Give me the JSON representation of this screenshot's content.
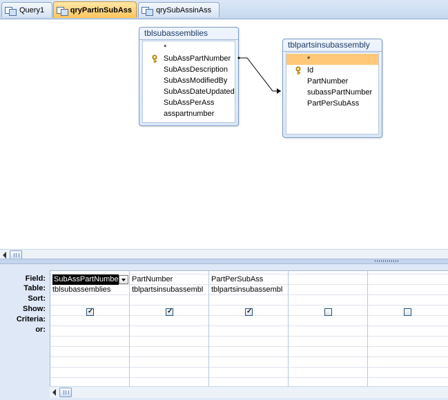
{
  "tabs": [
    {
      "label": "Query1",
      "active": false
    },
    {
      "label": "qryPartinSubAss",
      "active": true
    },
    {
      "label": "qrySubAssinAss",
      "active": false
    }
  ],
  "design": {
    "table1": {
      "title": "tblsubassemblies",
      "fields": [
        "*",
        "SubAssPartNumber",
        "SubAssDescription",
        "SubAssModifiedBy",
        "SubAssDateUpdated",
        "SubAssPerAss",
        "asspartnumber"
      ],
      "key_field_index": 1
    },
    "table2": {
      "title": "tblpartsinsubassembly",
      "fields": [
        "*",
        "Id",
        "PartNumber",
        "subassPartNumber",
        "PartPerSubAss"
      ],
      "key_field_index": 1,
      "selected_field_index": 0
    }
  },
  "grid": {
    "row_labels": [
      "Field:",
      "Table:",
      "Sort:",
      "Show:",
      "Criteria:",
      "or:"
    ],
    "columns": [
      {
        "field": "SubAssPartNumbe",
        "table": "tblsubassemblies",
        "sort": "",
        "show": true
      },
      {
        "field": "PartNumber",
        "table": "tblpartsinsubassembl",
        "sort": "",
        "show": true
      },
      {
        "field": "PartPerSubAss",
        "table": "tblpartsinsubassembl",
        "sort": "",
        "show": true
      },
      {
        "field": "",
        "table": "",
        "sort": "",
        "show": false
      },
      {
        "field": "",
        "table": "",
        "sort": "",
        "show": false
      }
    ]
  },
  "colors": {
    "active_tab": "#ffc55a",
    "selected_field": "#ffc878",
    "background": "#dfe8f6"
  }
}
